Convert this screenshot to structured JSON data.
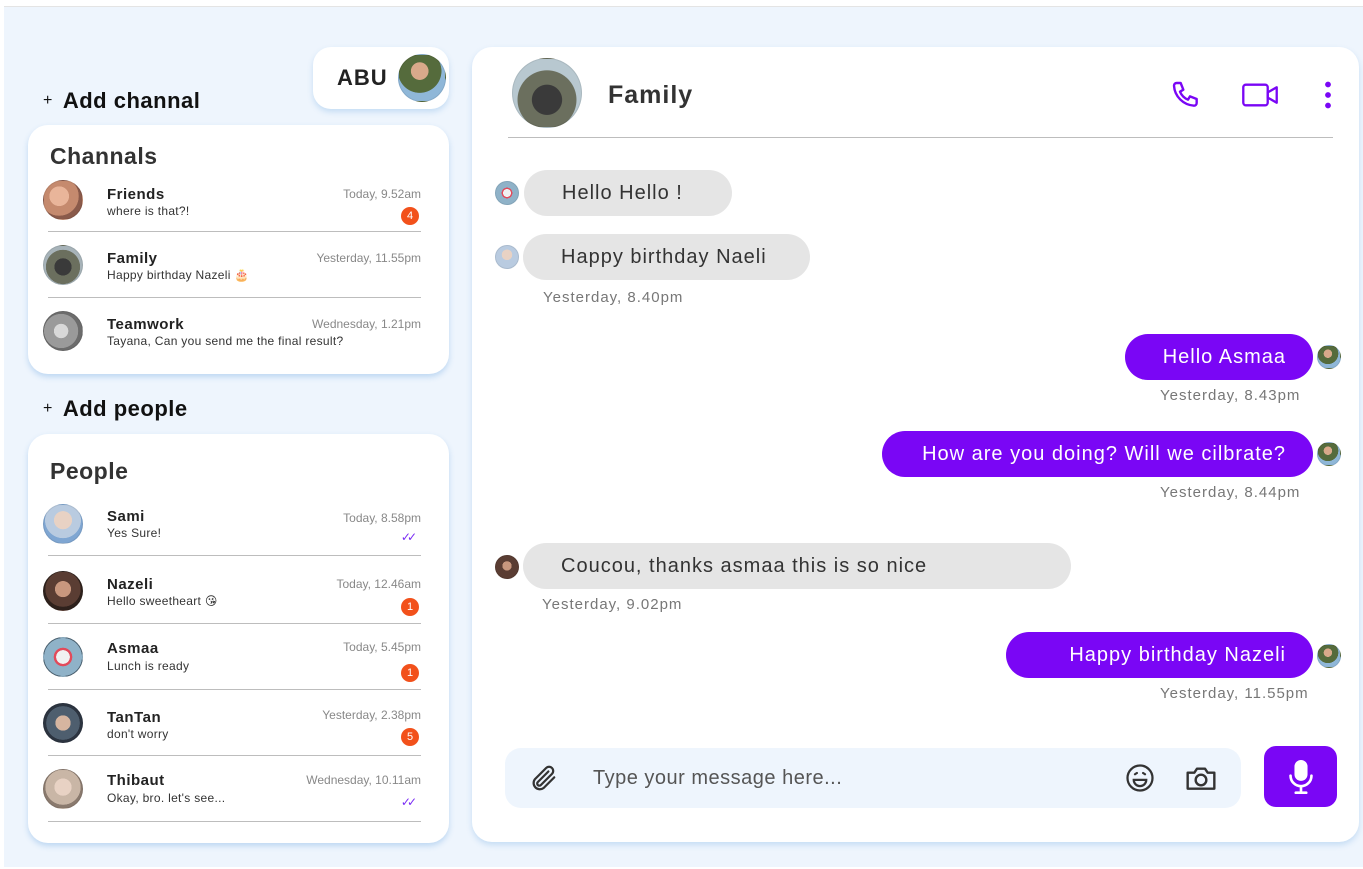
{
  "user": {
    "name": "ABU"
  },
  "channels_section": {
    "add_label": "Add channal",
    "title": "Channals",
    "items": [
      {
        "name": "Friends",
        "message": "where is that?!",
        "time": "Today, 9.52am",
        "badge": "4",
        "avatar_color": "#c58a6e"
      },
      {
        "name": "Family",
        "message": "Happy birthday Nazeli 🎂",
        "time": "Yesterday, 11.55pm",
        "badge": "",
        "avatar_color": "#6b6f5e"
      },
      {
        "name": "Teamwork",
        "message": "Tayana, Can you send me the final result?",
        "time": "Wednesday, 1.21pm",
        "badge": "",
        "avatar_color": "#9a9a9a"
      }
    ]
  },
  "people_section": {
    "add_label": "Add people",
    "title": "People",
    "items": [
      {
        "name": "Sami",
        "message": "Yes Sure!",
        "time": "Today, 8.58pm",
        "badge": "",
        "read": true,
        "avatar_color": "#b9cbe0"
      },
      {
        "name": "Nazeli",
        "message": "Hello sweetheart 😘",
        "time": "Today, 12.46am",
        "badge": "1",
        "read": false,
        "avatar_color": "#5a3d33"
      },
      {
        "name": "Asmaa",
        "message": "Lunch is ready",
        "time": "Today, 5.45pm",
        "badge": "1",
        "read": false,
        "avatar_color": "#8fb2c8"
      },
      {
        "name": "TanTan",
        "message": "don't worry",
        "time": "Yesterday, 2.38pm",
        "badge": "5",
        "read": false,
        "avatar_color": "#4e5e6e"
      },
      {
        "name": "Thibaut",
        "message": "Okay, bro. let's see...",
        "time": "Wednesday, 10.11am",
        "badge": "",
        "read": true,
        "avatar_color": "#c9b6a6"
      }
    ]
  },
  "chat": {
    "title": "Family",
    "icons": [
      "phone-icon",
      "video-camera-icon",
      "more-vertical-icon"
    ],
    "messages": [
      {
        "text": "Hello Hello !",
        "direction": "in",
        "time": ""
      },
      {
        "text": "Happy birthday Naeli",
        "direction": "in",
        "time": "Yesterday, 8.40pm"
      },
      {
        "text": "Hello Asmaa",
        "direction": "out",
        "time": "Yesterday, 8.43pm"
      },
      {
        "text": "How are you doing? Will we cilbrate?",
        "direction": "out",
        "time": "Yesterday, 8.44pm"
      },
      {
        "text": "Coucou, thanks asmaa this is so nice",
        "direction": "in",
        "time": "Yesterday, 9.02pm"
      },
      {
        "text": "Happy birthday Nazeli",
        "direction": "out",
        "time": "Yesterday, 11.55pm"
      }
    ]
  },
  "composer": {
    "placeholder": "Type your message here...",
    "icons": [
      "paperclip-icon",
      "emoji-icon",
      "camera-icon",
      "microphone-icon"
    ]
  },
  "colors": {
    "accent": "#7a06f5",
    "badge": "#f2511b",
    "background": "#eef5fd",
    "incoming_bubble": "#e5e5e5"
  }
}
